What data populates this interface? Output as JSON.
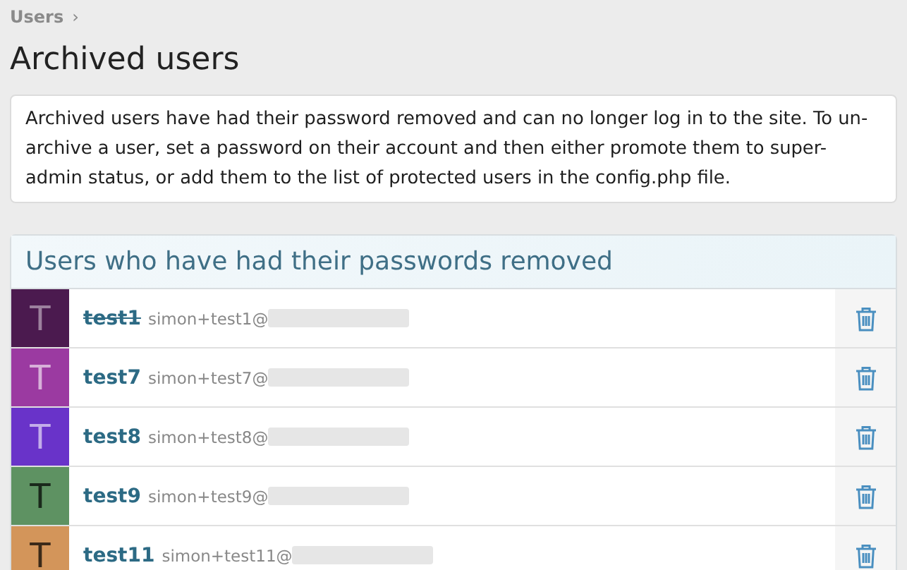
{
  "breadcrumb": {
    "label": "Users",
    "separator": "›"
  },
  "title": "Archived users",
  "info": "Archived users have had their password removed and can no longer log in to the site. To un-archive a user, set a password on their account and then either promote them to super-admin status, or add them to the list of protected users in the config.php file.",
  "panel": {
    "title": "Users who have had their passwords removed",
    "users": [
      {
        "initial": "T",
        "color": "#4b1a4f",
        "name": "test1",
        "strikethrough": true,
        "email": "simon+test1@"
      },
      {
        "initial": "T",
        "color": "#9b3aa1",
        "name": "test7",
        "strikethrough": false,
        "email": "simon+test7@"
      },
      {
        "initial": "T",
        "color": "#6933c9",
        "name": "test8",
        "strikethrough": false,
        "email": "simon+test8@"
      },
      {
        "initial": "T",
        "color": "#5e9262",
        "name": "test9",
        "strikethrough": false,
        "email": "simon+test9@"
      },
      {
        "initial": "T",
        "color": "#d3955a",
        "name": "test11",
        "strikethrough": false,
        "email": "simon+test11@"
      }
    ]
  }
}
